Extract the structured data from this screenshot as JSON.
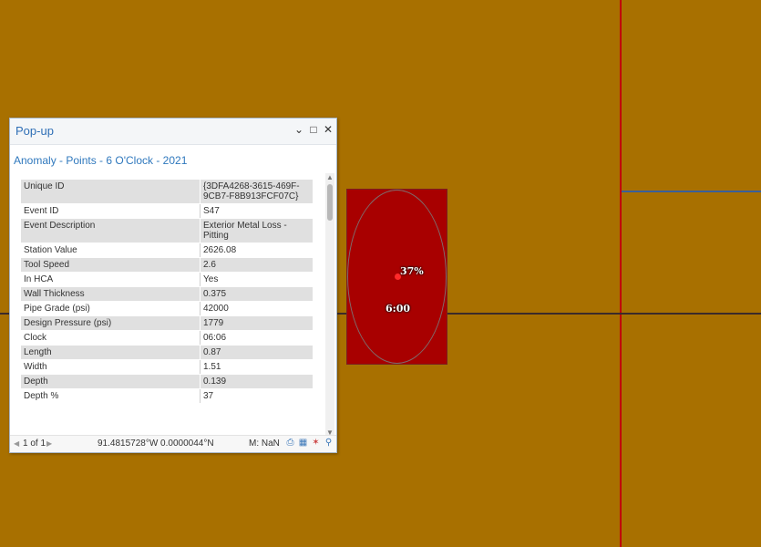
{
  "popup": {
    "title": "Pop-up",
    "layer_title": "Anomaly - Points - 6 O'Clock - 2021",
    "header_icons": [
      "chevron-down-icon",
      "maximize-icon",
      "close-icon"
    ],
    "rows": [
      {
        "field": "Unique ID",
        "value": "{3DFA4268-3615-469F-9CB7-F8B913FCF07C}"
      },
      {
        "field": "Event ID",
        "value": "S47"
      },
      {
        "field": "Event Description",
        "value": "Exterior Metal Loss - Pitting"
      },
      {
        "field": "Station Value",
        "value": "2626.08"
      },
      {
        "field": "Tool Speed",
        "value": "2.6"
      },
      {
        "field": "In HCA",
        "value": "Yes"
      },
      {
        "field": "Wall Thickness",
        "value": "0.375"
      },
      {
        "field": "Pipe Grade (psi)",
        "value": "42000"
      },
      {
        "field": "Design Pressure (psi)",
        "value": "1779"
      },
      {
        "field": "Clock",
        "value": "06:06"
      },
      {
        "field": "Length",
        "value": "0.87"
      },
      {
        "field": "Width",
        "value": "1.51"
      },
      {
        "field": "Depth",
        "value": "0.139"
      },
      {
        "field": "Depth %",
        "value": "37"
      }
    ],
    "footer": {
      "nav_count": "1 of 1",
      "coordinates": "91.4815728°W 0.0000044°N",
      "measure": "M: NaN",
      "icons": [
        "print-icon",
        "export-icon",
        "flash-icon",
        "zoom-icon"
      ]
    }
  },
  "map": {
    "anomaly_label_pct": "37%",
    "anomaly_label_clock": "6:00",
    "background_color": "#A87000",
    "anomaly_color": "#A80000",
    "line_color_red": "#C0000A",
    "line_color_blue": "#3A5F9A"
  }
}
